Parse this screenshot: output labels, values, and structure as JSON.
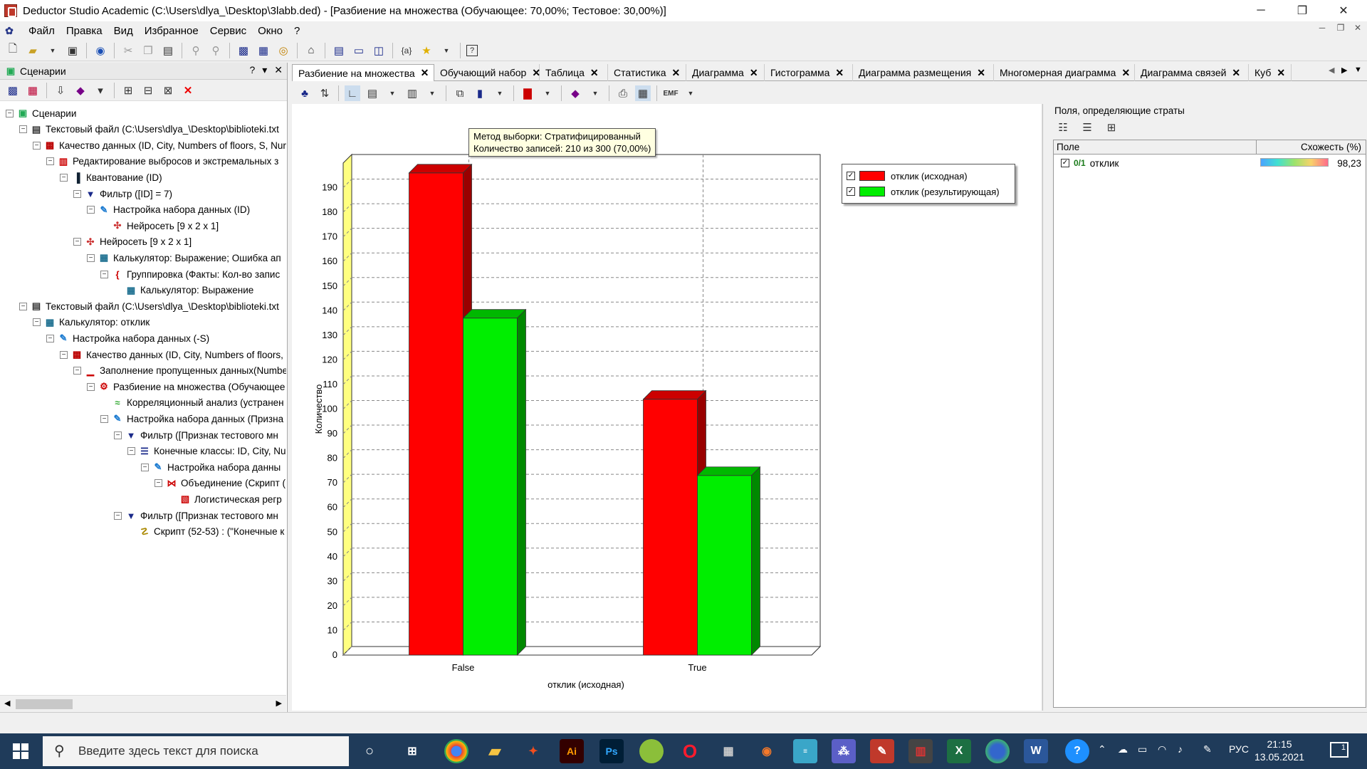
{
  "window": {
    "title": "Deductor Studio Academic (C:\\Users\\dlya_\\Desktop\\3labb.ded) - [Разбиение на множества (Обучающее: 70,00%; Тестовое: 30,00%)]",
    "minimize": "─",
    "maximize": "❐",
    "close": "✕"
  },
  "menu": {
    "items": [
      "Файл",
      "Правка",
      "Вид",
      "Избранное",
      "Сервис",
      "Окно",
      "?"
    ]
  },
  "left_panel": {
    "title": "Сценарии",
    "help": "?",
    "pin": "▾",
    "close": "✕",
    "tree": [
      {
        "level": 0,
        "label": "Сценарии",
        "icon": "scenarios-icon"
      },
      {
        "level": 1,
        "label": "Текстовый файл (C:\\Users\\dlya_\\Desktop\\biblioteki.txt",
        "icon": "text-file-icon"
      },
      {
        "level": 2,
        "label": "Качество данных (ID, City, Numbers of floors, S, Nur",
        "icon": "data-quality-icon"
      },
      {
        "level": 3,
        "label": "Редактирование выбросов и экстремальных з",
        "icon": "outliers-icon"
      },
      {
        "level": 4,
        "label": "Квантование (ID)",
        "icon": "quantization-icon"
      },
      {
        "level": 5,
        "label": "Фильтр ([ID] = 7)",
        "icon": "filter-icon"
      },
      {
        "level": 6,
        "label": "Настройка набора данных (ID)",
        "icon": "dataset-settings-icon"
      },
      {
        "level": 7,
        "label": "Нейросеть [9 x 2 x 1]",
        "icon": "neural-net-icon"
      },
      {
        "level": 5,
        "label": "Нейросеть [9 x 2 x 1]",
        "icon": "neural-net-icon"
      },
      {
        "level": 6,
        "label": "Калькулятор: Выражение; Ошибка ап",
        "icon": "calculator-icon"
      },
      {
        "level": 7,
        "label": "Группировка (Факты: Кол-во запис",
        "icon": "grouping-icon"
      },
      {
        "level": 8,
        "label": "Калькулятор: Выражение",
        "icon": "calculator-icon"
      },
      {
        "level": 1,
        "label": "Текстовый файл (C:\\Users\\dlya_\\Desktop\\biblioteki.txt",
        "icon": "text-file-icon"
      },
      {
        "level": 2,
        "label": "Калькулятор: отклик",
        "icon": "calculator-icon"
      },
      {
        "level": 3,
        "label": "Настройка набора данных (-S)",
        "icon": "dataset-settings-icon"
      },
      {
        "level": 4,
        "label": "Качество данных (ID, City, Numbers of floors,",
        "icon": "data-quality-icon"
      },
      {
        "level": 5,
        "label": "Заполнение пропущенных данных(Numbe",
        "icon": "fill-missing-icon"
      },
      {
        "level": 6,
        "label": "Разбиение на множества (Обучающее",
        "icon": "split-icon"
      },
      {
        "level": 7,
        "label": "Корреляционный анализ (устранен",
        "icon": "correlation-icon"
      },
      {
        "level": 7,
        "label": "Настройка набора данных (Призна",
        "icon": "dataset-settings-icon"
      },
      {
        "level": 8,
        "label": "Фильтр ([Признак тестового мн",
        "icon": "filter-icon"
      },
      {
        "level": 9,
        "label": "Конечные классы: ID, City, Nu",
        "icon": "classes-icon"
      },
      {
        "level": 10,
        "label": "Настройка набора данны",
        "icon": "dataset-settings-icon"
      },
      {
        "level": 11,
        "label": "Объединение (Скрипт (",
        "icon": "merge-icon"
      },
      {
        "level": 12,
        "label": "Логистическая регр",
        "icon": "logistic-icon"
      },
      {
        "level": 8,
        "label": "Фильтр ([Признак тестового мн",
        "icon": "filter-icon"
      },
      {
        "level": 9,
        "label": "Скрипт (52-53) : (\"Конечные к",
        "icon": "script-icon"
      }
    ]
  },
  "tabs": [
    "Разбиение на множества",
    "Обучающий набор",
    "Таблица",
    "Статистика",
    "Диаграмма",
    "Гистограмма",
    "Диаграмма размещения",
    "Многомерная диаграмма",
    "Диаграмма связей",
    "Куб"
  ],
  "tooltip": {
    "line1": "Метод выборки: Стратифицированный",
    "line2": "Количество записей: 210 из 300 (70,00%)"
  },
  "chart_data": {
    "type": "bar",
    "categories": [
      "False",
      "True"
    ],
    "series": [
      {
        "name": "отклик (исходная)",
        "values": [
          196,
          104
        ],
        "color": "#ff0000"
      },
      {
        "name": "отклик (результирующая)",
        "values": [
          137,
          73
        ],
        "color": "#00ee00"
      }
    ],
    "xlabel": "отклик (исходная)",
    "ylabel": "Количество",
    "ylim": [
      0,
      200
    ],
    "yticks": [
      0,
      10,
      20,
      30,
      40,
      50,
      60,
      70,
      80,
      90,
      100,
      110,
      120,
      130,
      140,
      150,
      160,
      170,
      180,
      190
    ],
    "grid": true,
    "legend": "top-right",
    "style": "3d"
  },
  "right_panel": {
    "title": "Поля, определяющие страты",
    "col_field": "Поле",
    "col_similarity": "Схожесть (%)",
    "rows": [
      {
        "field": "отклик",
        "similarity": "98,23",
        "type_icon": "0/1",
        "checked": "✓"
      }
    ]
  },
  "taskbar": {
    "search_placeholder": "Введите здесь текст для поиска",
    "lang": "РУС",
    "time": "21:15",
    "date": "13.05.2021",
    "notify": "1"
  }
}
